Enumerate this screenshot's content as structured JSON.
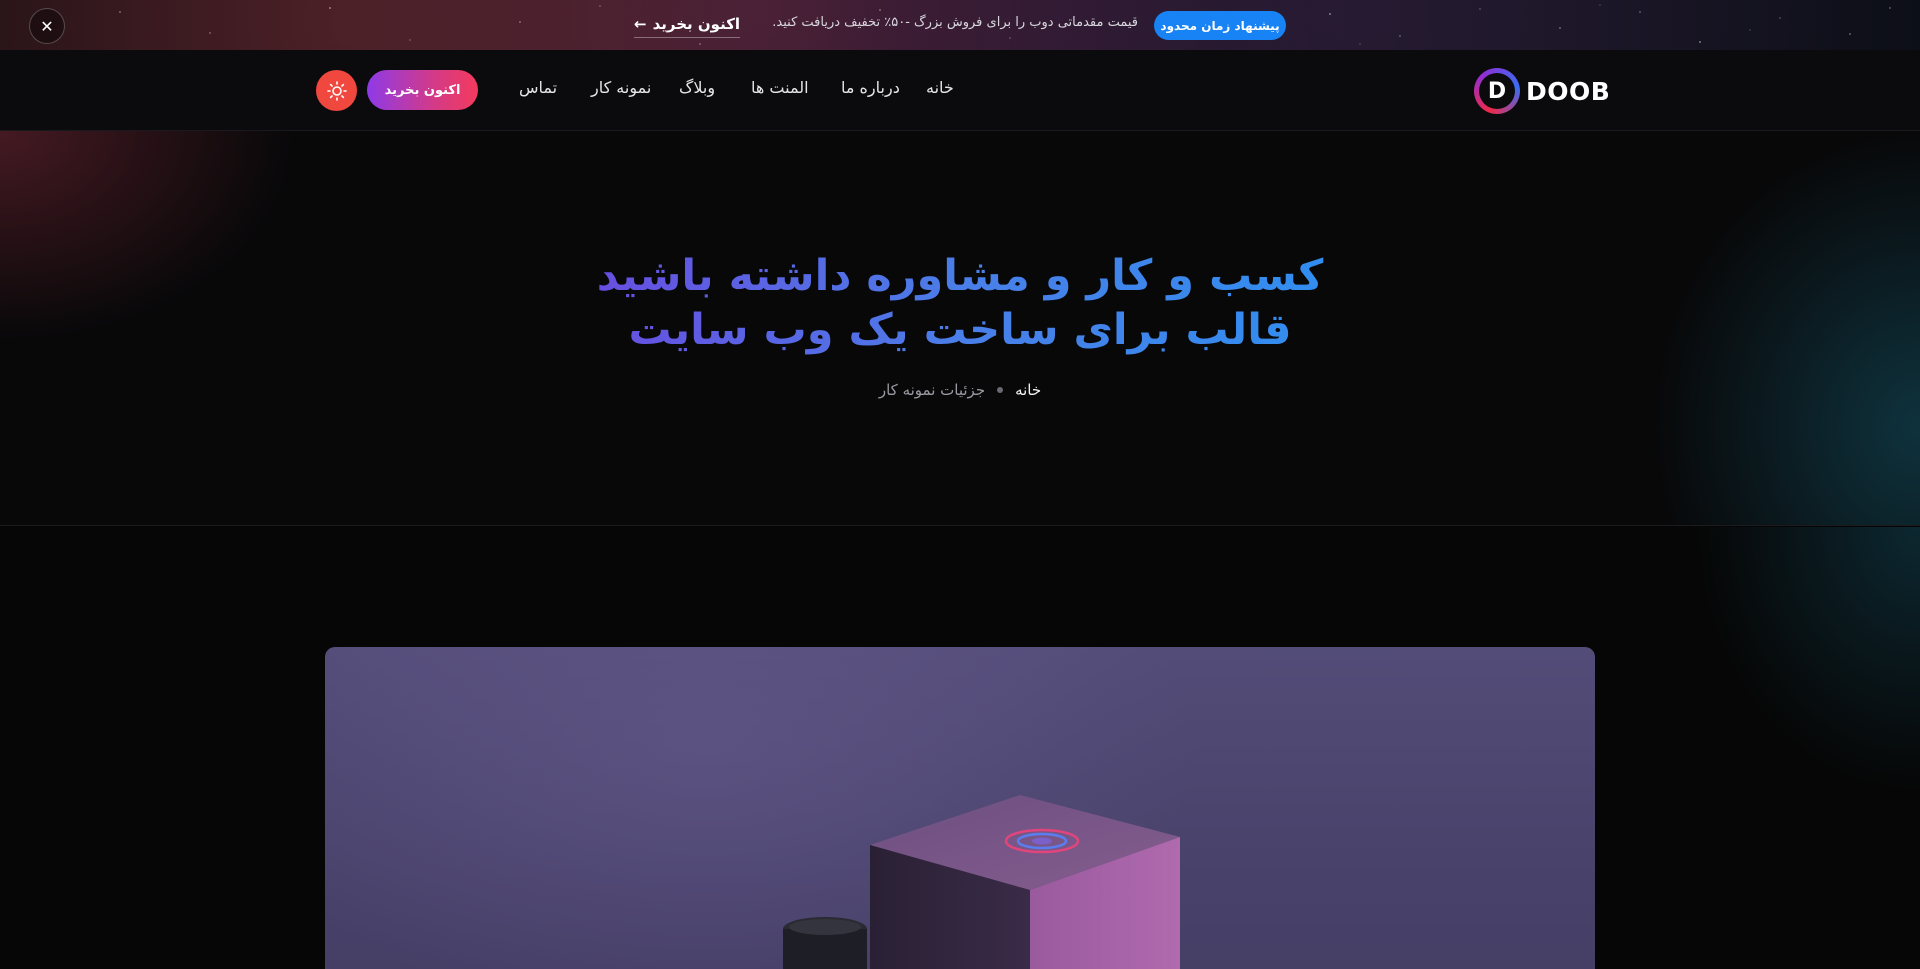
{
  "topbar": {
    "badge": "پیشنهاد زمان محدود",
    "text": "قیمت مقدماتی دوب را برای فروش بزرگ -۵۰٪ تخفیف دریافت کنید.",
    "buy_label": "اکنون بخرید",
    "close_label": "✕"
  },
  "header": {
    "logo_text": "DOOB",
    "logo_letter": "D",
    "nav": [
      {
        "label": "خانه"
      },
      {
        "label": "درباره ما"
      },
      {
        "label": "المنت ها"
      },
      {
        "label": "وبلاگ"
      },
      {
        "label": "نمونه کار"
      },
      {
        "label": "تماس"
      }
    ],
    "cta_label": "اکنون بخرید"
  },
  "hero": {
    "title_line1": "کسب و کار و مشاوره داشته باشید",
    "title_line2": "قالب برای ساخت یک وب سایت",
    "breadcrumb": {
      "home": "خانه",
      "current": "جزئیات نمونه کار"
    }
  },
  "colors": {
    "accent_blue": "#1783f4",
    "cta_gradient_start": "#8e3ae8",
    "cta_gradient_end": "#f43a5d",
    "theme_toggle": "#f0473e",
    "title_gradient_start": "#6a4ae0",
    "title_gradient_end": "#2f8ff0"
  }
}
